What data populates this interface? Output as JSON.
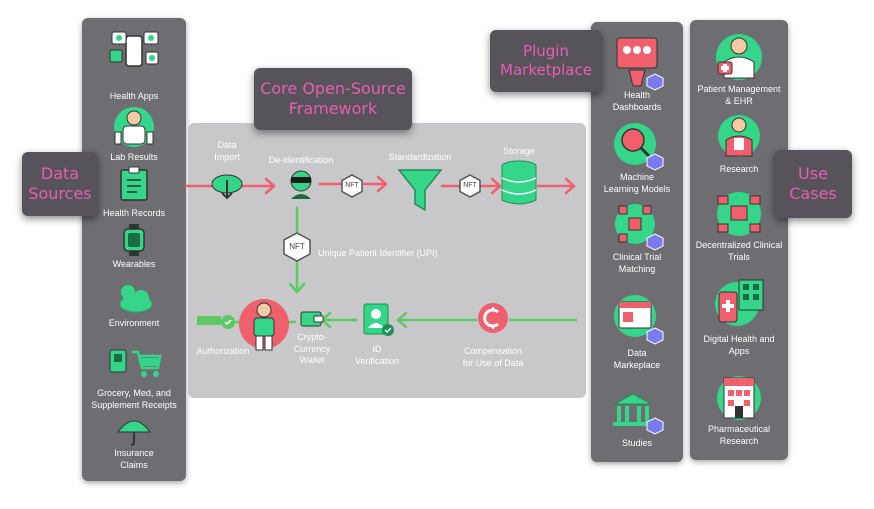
{
  "titles": {
    "data_sources": "Data\nSources",
    "core": "Core Open-Source\nFramework",
    "plugin": "Plugin\nMarketplace",
    "use_cases": "Use\nCases"
  },
  "data_sources": [
    {
      "label": "Health Apps",
      "icon": "phone-apps-icon"
    },
    {
      "label": "Lab Results",
      "icon": "scientist-icon"
    },
    {
      "label": "Health Records",
      "icon": "clipboard-icon"
    },
    {
      "label": "Wearables",
      "icon": "smartwatch-icon"
    },
    {
      "label": "Environment",
      "icon": "cloud-sun-icon"
    },
    {
      "label": "Grocery, Med, and\nSupplement Receipts",
      "icon": "cart-icon"
    },
    {
      "label": "Insurance\nClaims",
      "icon": "umbrella-icon"
    }
  ],
  "pipeline_top": [
    {
      "label": "Data\nImport",
      "icon": "cloud-download-icon"
    },
    {
      "label": "De-identification",
      "icon": "masked-person-icon"
    },
    {
      "label": "Standardization",
      "icon": "funnel-icon"
    },
    {
      "label": "Storage",
      "icon": "database-icon"
    }
  ],
  "nft_label": "NFT",
  "upi_label": "Unique Patient Identifier (UPI)",
  "pipeline_bottom": [
    {
      "label": "Compensation\nfor Use of Data",
      "icon": "crypto-coin-icon"
    },
    {
      "label": "ID\nVerification",
      "icon": "id-badge-icon"
    },
    {
      "label": "Crypto-\nCurrency\nWallet",
      "icon": "wallet-icon"
    },
    {
      "label": "Authorization",
      "icon": "key-icon"
    }
  ],
  "plugins": [
    {
      "label": "Health\nDashboards",
      "icon": "dashboard-icon"
    },
    {
      "label": "Machine\nLearning Models",
      "icon": "brain-search-icon"
    },
    {
      "label": "Clinical Trial\nMatching",
      "icon": "network-icon"
    },
    {
      "label": "Data\nMarkeplace",
      "icon": "browser-icon"
    },
    {
      "label": "Studies",
      "icon": "institution-icon"
    }
  ],
  "use_cases": [
    {
      "label": "Patient Management\n& EHR",
      "icon": "doctor-icon"
    },
    {
      "label": "Research",
      "icon": "researcher-icon"
    },
    {
      "label": "Decentralized Clinical\nTrials",
      "icon": "trial-network-icon"
    },
    {
      "label": "Digital  Health and\nApps",
      "icon": "digital-health-icon"
    },
    {
      "label": "Pharmaceutical\nResearch",
      "icon": "pharma-building-icon"
    }
  ],
  "colors": {
    "accent_green": "#35d58a",
    "accent_pink": "#e85db0",
    "arrow_red": "#ef5f6d",
    "arrow_green": "#5cc964",
    "panel": "#6d6d72",
    "core": "#c8c8ca"
  }
}
